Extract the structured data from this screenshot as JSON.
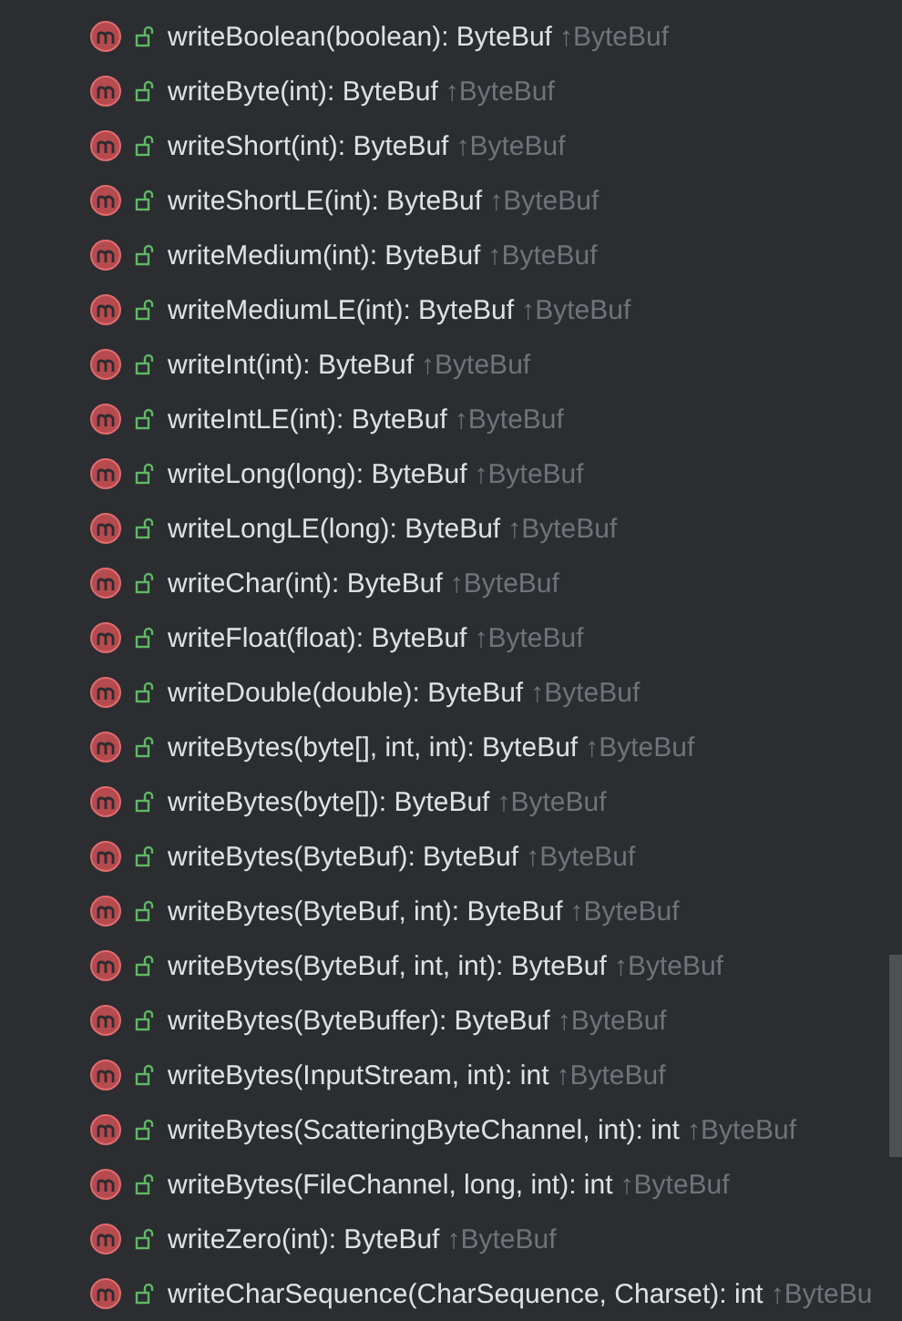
{
  "members": [
    {
      "signature": "writeBoolean(boolean): ByteBuf",
      "origin": "↑ByteBuf"
    },
    {
      "signature": "writeByte(int): ByteBuf",
      "origin": "↑ByteBuf"
    },
    {
      "signature": "writeShort(int): ByteBuf",
      "origin": "↑ByteBuf"
    },
    {
      "signature": "writeShortLE(int): ByteBuf",
      "origin": "↑ByteBuf"
    },
    {
      "signature": "writeMedium(int): ByteBuf",
      "origin": "↑ByteBuf"
    },
    {
      "signature": "writeMediumLE(int): ByteBuf",
      "origin": "↑ByteBuf"
    },
    {
      "signature": "writeInt(int): ByteBuf",
      "origin": "↑ByteBuf"
    },
    {
      "signature": "writeIntLE(int): ByteBuf",
      "origin": "↑ByteBuf"
    },
    {
      "signature": "writeLong(long): ByteBuf",
      "origin": "↑ByteBuf"
    },
    {
      "signature": "writeLongLE(long): ByteBuf",
      "origin": "↑ByteBuf"
    },
    {
      "signature": "writeChar(int): ByteBuf",
      "origin": "↑ByteBuf"
    },
    {
      "signature": "writeFloat(float): ByteBuf",
      "origin": "↑ByteBuf"
    },
    {
      "signature": "writeDouble(double): ByteBuf",
      "origin": "↑ByteBuf"
    },
    {
      "signature": "writeBytes(byte[], int, int): ByteBuf",
      "origin": "↑ByteBuf"
    },
    {
      "signature": "writeBytes(byte[]): ByteBuf",
      "origin": "↑ByteBuf"
    },
    {
      "signature": "writeBytes(ByteBuf): ByteBuf",
      "origin": "↑ByteBuf"
    },
    {
      "signature": "writeBytes(ByteBuf, int): ByteBuf",
      "origin": "↑ByteBuf"
    },
    {
      "signature": "writeBytes(ByteBuf, int, int): ByteBuf",
      "origin": "↑ByteBuf"
    },
    {
      "signature": "writeBytes(ByteBuffer): ByteBuf",
      "origin": "↑ByteBuf"
    },
    {
      "signature": "writeBytes(InputStream, int): int",
      "origin": "↑ByteBuf"
    },
    {
      "signature": "writeBytes(ScatteringByteChannel, int): int",
      "origin": "↑ByteBuf"
    },
    {
      "signature": "writeBytes(FileChannel, long, int): int",
      "origin": "↑ByteBuf"
    },
    {
      "signature": "writeZero(int): ByteBuf",
      "origin": "↑ByteBuf"
    },
    {
      "signature": "writeCharSequence(CharSequence, Charset): int",
      "origin": "↑ByteBu"
    }
  ]
}
